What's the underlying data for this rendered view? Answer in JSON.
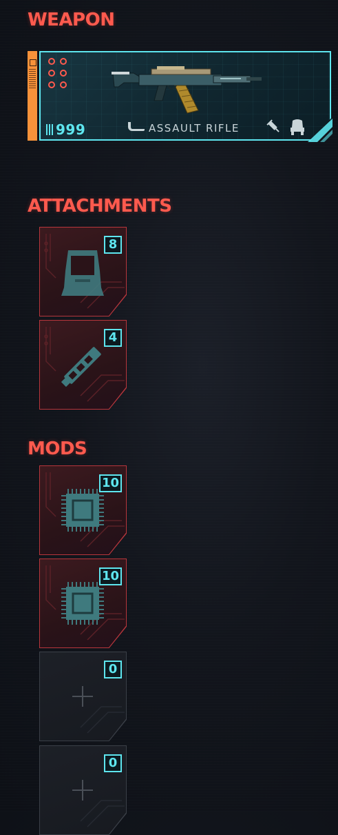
{
  "sections": {
    "weapon_title": "WEAPON",
    "attachments_title": "ATTACHMENTS",
    "mods_title": "MODS"
  },
  "weapon": {
    "ammo": "999",
    "type_label": "ASSAULT RIFLE",
    "mod_slots": 6,
    "icons": [
      "ammo-icon",
      "assault-rifle-type-icon",
      "syringe-icon",
      "vehicle-seat-icon"
    ]
  },
  "attachments": [
    {
      "icon": "scope-icon",
      "count": "8"
    },
    {
      "icon": "silencer-icon",
      "count": "4"
    }
  ],
  "mods": [
    {
      "icon": "chip-icon",
      "count": "10",
      "state": "filled"
    },
    {
      "icon": "chip-icon",
      "count": "10",
      "state": "filled"
    },
    {
      "icon": "plus-icon",
      "count": "0",
      "state": "empty"
    },
    {
      "icon": "plus-icon",
      "count": "0",
      "state": "empty"
    }
  ],
  "colors": {
    "title_red": "#ff5a4e",
    "accent_cyan": "#5ee6ef",
    "tab_orange": "#f7923a",
    "slot_border_red": "#b8363c",
    "empty_border": "#3a3f47"
  }
}
